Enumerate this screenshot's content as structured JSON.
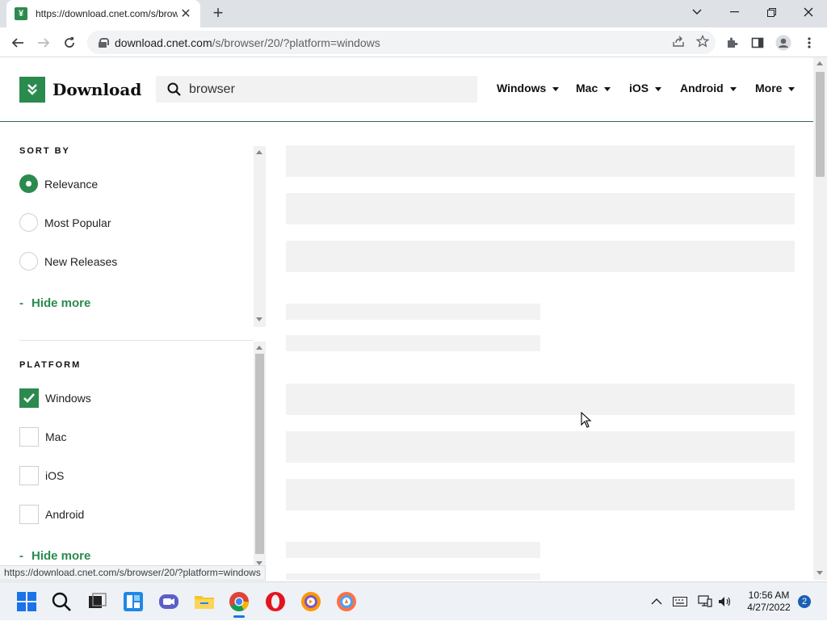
{
  "browser": {
    "tab_title": "https://download.cnet.com/s/browser/20/?platform=windows",
    "url_domain": "download.cnet.com",
    "url_path": "/s/browser/20/?platform=windows",
    "status_url": "https://download.cnet.com/s/browser/20/?platform=windows"
  },
  "site": {
    "logo_text": "Download",
    "search_value": "browser",
    "nav": [
      "Windows",
      "Mac",
      "iOS",
      "Android",
      "More"
    ]
  },
  "sidebar": {
    "sort_title": "SORT BY",
    "sort_options": [
      {
        "label": "Relevance",
        "selected": true
      },
      {
        "label": "Most Popular",
        "selected": false
      },
      {
        "label": "New Releases",
        "selected": false
      }
    ],
    "platform_title": "PLATFORM",
    "platform_options": [
      {
        "label": "Windows",
        "checked": true
      },
      {
        "label": "Mac",
        "checked": false
      },
      {
        "label": "iOS",
        "checked": false
      },
      {
        "label": "Android",
        "checked": false
      }
    ],
    "hide_more": "Hide more",
    "hide_more_dash": "-"
  },
  "taskbar": {
    "time": "10:56 AM",
    "date": "4/27/2022",
    "notifications": "2"
  },
  "colors": {
    "brand_green": "#2b8b4e"
  }
}
